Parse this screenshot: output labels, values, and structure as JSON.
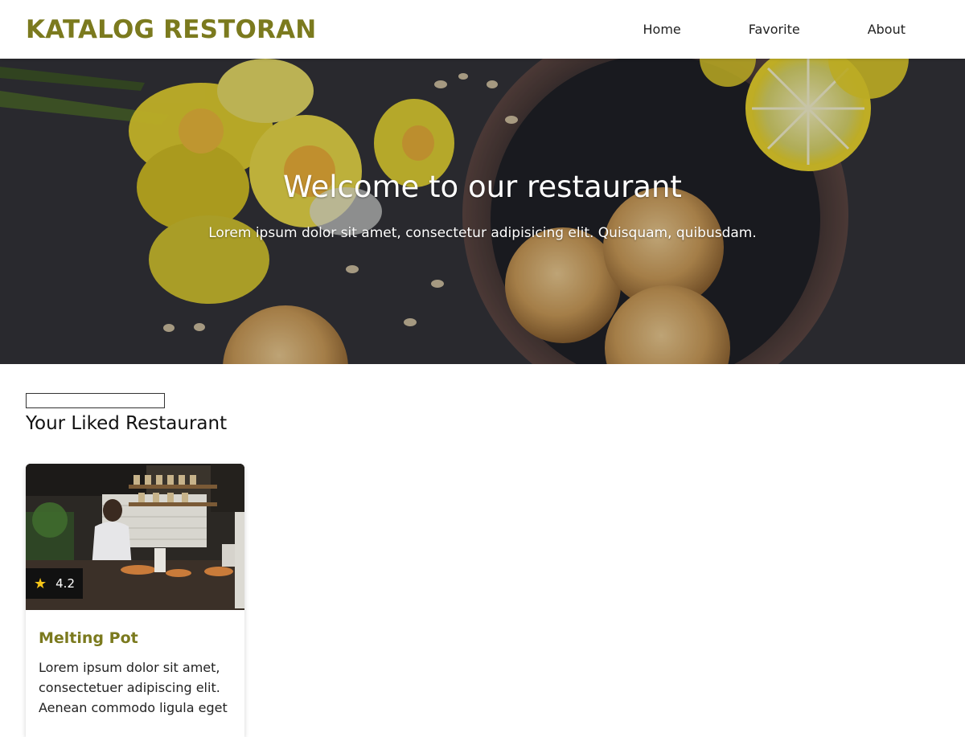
{
  "header": {
    "brand": "KATALOG RESTORAN",
    "nav": [
      {
        "label": "Home"
      },
      {
        "label": "Favorite"
      },
      {
        "label": "About"
      }
    ]
  },
  "hero": {
    "title": "Welcome to our restaurant",
    "subtitle": "Lorem ipsum dolor sit amet, consectetur adipisicing elit. Quisquam, quibusdam."
  },
  "favorites": {
    "search_value": "",
    "title": "Your Liked Restaurant",
    "restaurants": [
      {
        "name": "Melting Pot",
        "rating": "4.2",
        "description": "Lorem ipsum dolor sit amet, consectetuer adipiscing elit. Aenean commodo ligula eget"
      }
    ]
  },
  "colors": {
    "accent": "#7b7a1e",
    "hero_overlay": "#2c2d33",
    "star": "#f5c518"
  },
  "icons": {
    "rating": "star-icon"
  }
}
